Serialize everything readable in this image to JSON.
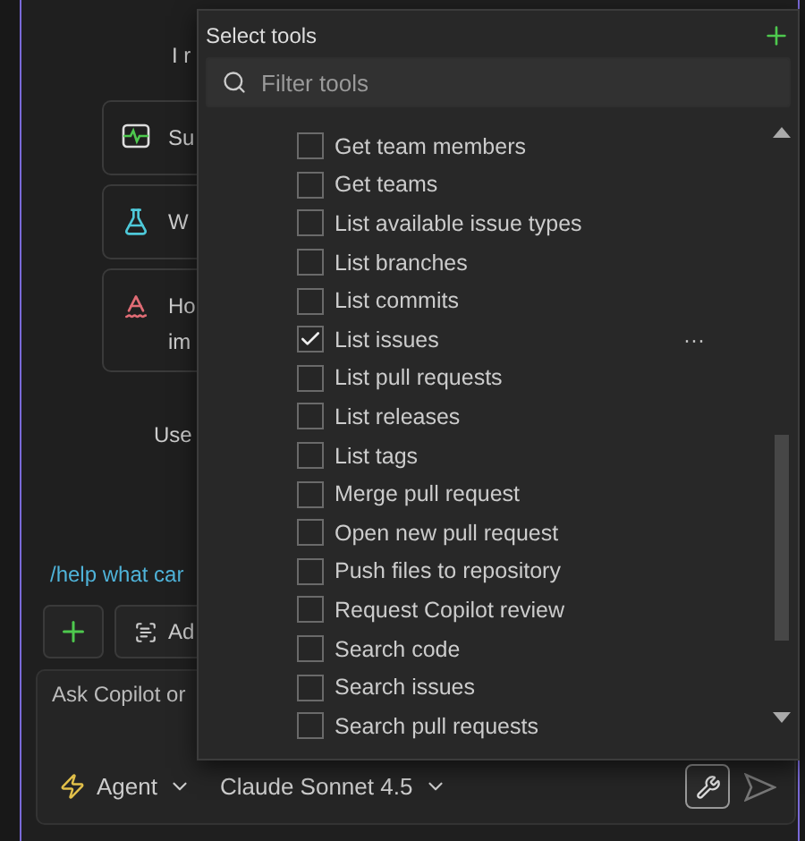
{
  "chat": {
    "intro": "I r",
    "suggestions": [
      {
        "kind": "health",
        "text": "Su"
      },
      {
        "kind": "test",
        "text": "W"
      },
      {
        "kind": "spell",
        "text": "Ho\nim"
      }
    ],
    "hint": "Use",
    "help_link": "/help what car",
    "add_context": "Ad",
    "input": {
      "placeholder": "Ask Copilot or"
    },
    "mode": "Agent",
    "model": "Claude Sonnet 4.5"
  },
  "tools_popup": {
    "title": "Select tools",
    "filter": {
      "placeholder": "Filter tools"
    },
    "items": [
      {
        "label": "Get team members",
        "checked": false
      },
      {
        "label": "Get teams",
        "checked": false
      },
      {
        "label": "List available issue types",
        "checked": false
      },
      {
        "label": "List branches",
        "checked": false
      },
      {
        "label": "List commits",
        "checked": false
      },
      {
        "label": "List issues",
        "checked": true,
        "actions": "···"
      },
      {
        "label": "List pull requests",
        "checked": false
      },
      {
        "label": "List releases",
        "checked": false
      },
      {
        "label": "List tags",
        "checked": false
      },
      {
        "label": "Merge pull request",
        "checked": false
      },
      {
        "label": "Open new pull request",
        "checked": false
      },
      {
        "label": "Push files to repository",
        "checked": false
      },
      {
        "label": "Request Copilot review",
        "checked": false
      },
      {
        "label": "Search code",
        "checked": false
      },
      {
        "label": "Search issues",
        "checked": false
      },
      {
        "label": "Search pull requests",
        "checked": false
      }
    ]
  }
}
